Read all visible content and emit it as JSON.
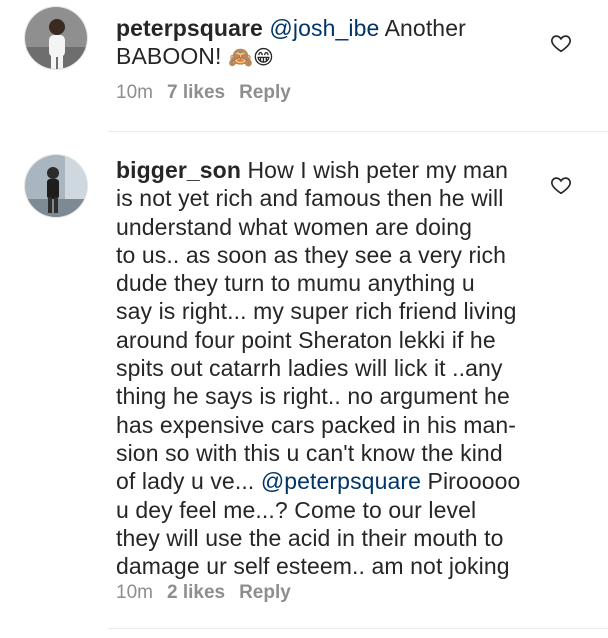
{
  "comments": [
    {
      "username": "peterpsquare",
      "mention": "@josh_ibe",
      "text_lines": [
        "Another",
        "BABOON!"
      ],
      "emoji": "🙈😁",
      "time": "10m",
      "likes": "7 likes",
      "reply": "Reply",
      "icons": {
        "like": "heart-outline-icon"
      }
    },
    {
      "username": "bigger_son",
      "text_lines": [
        "How I wish peter my man",
        "is not yet rich and famous then he will",
        "understand what women are doing",
        "to us.. as soon as they see a very rich",
        "dude they turn to mumu anything u",
        "say is right... my super rich friend living",
        "around four point Sheraton lekki if he",
        "spits out catarrh ladies will lick it ..any",
        "thing he says is right.. no argument he",
        "has expensive cars packed in his man-",
        "sion so with this u can't know the kind",
        "of lady u ve...",
        "Pirooooo",
        "u dey feel me...? Come to our level",
        "they will use the acid in their mouth to",
        "damage ur self esteem.. am not joking"
      ],
      "mention": "@peterpsquare",
      "time": "10m",
      "likes": "2 likes",
      "reply": "Reply",
      "icons": {
        "like": "heart-outline-icon"
      }
    }
  ],
  "colors": {
    "text": "#262626",
    "mention": "#003569",
    "meta": "#8e8e8e"
  }
}
